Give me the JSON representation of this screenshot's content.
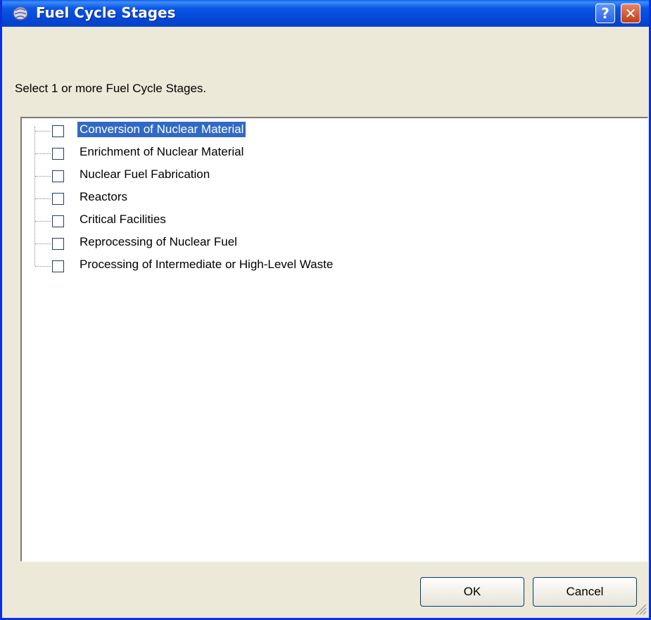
{
  "window": {
    "title": "Fuel Cycle Stages",
    "help_glyph": "?",
    "close_glyph": "✕"
  },
  "prompt": "Select 1 or more Fuel Cycle Stages.",
  "stages": [
    {
      "label": "Conversion of Nuclear Material",
      "checked": false,
      "selected": true
    },
    {
      "label": "Enrichment of Nuclear Material",
      "checked": false,
      "selected": false
    },
    {
      "label": "Nuclear Fuel Fabrication",
      "checked": false,
      "selected": false
    },
    {
      "label": "Reactors",
      "checked": false,
      "selected": false
    },
    {
      "label": "Critical Facilities",
      "checked": false,
      "selected": false
    },
    {
      "label": "Reprocessing of Nuclear Fuel",
      "checked": false,
      "selected": false
    },
    {
      "label": "Processing of Intermediate or High-Level Waste",
      "checked": false,
      "selected": false
    }
  ],
  "buttons": {
    "ok": "OK",
    "cancel": "Cancel"
  },
  "colors": {
    "titlebar": "#0548d6",
    "selection": "#316ac5",
    "face": "#ece9d8"
  }
}
